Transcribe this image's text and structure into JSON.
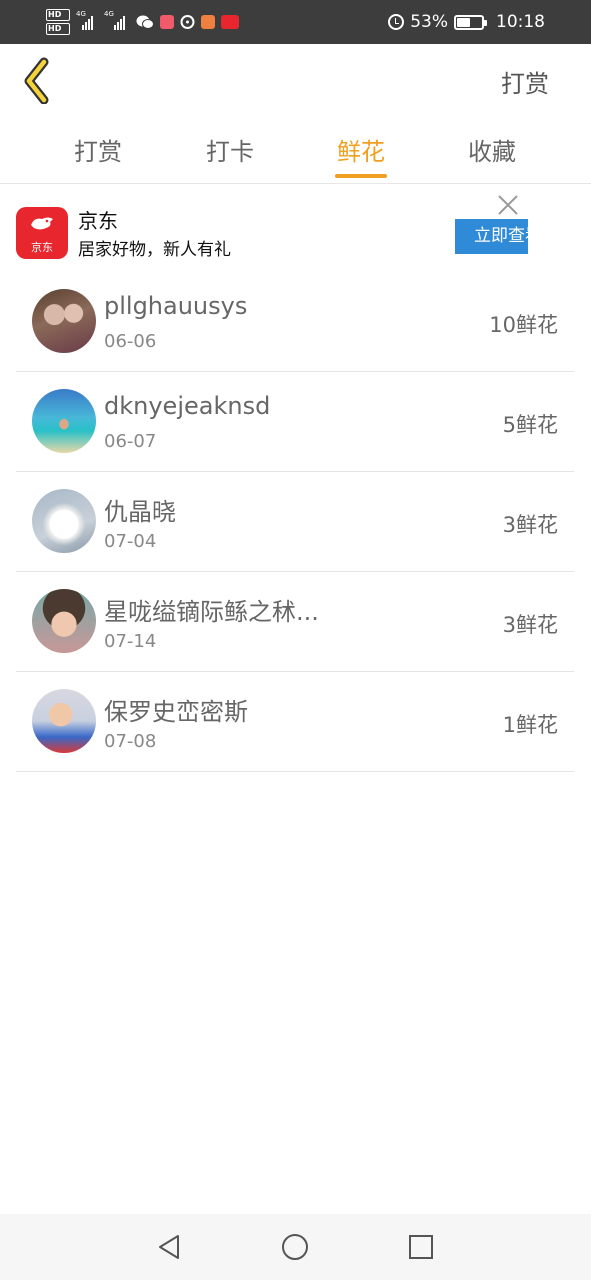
{
  "status_bar": {
    "battery_percent": "53%",
    "battery_level": 0.53,
    "time": "10:18",
    "hd1": "HD",
    "hd2": "HD",
    "net1": "4G",
    "net2": "4G"
  },
  "header": {
    "right_action": "打赏"
  },
  "tabs": [
    {
      "label": "打赏",
      "active": false
    },
    {
      "label": "打卡",
      "active": false
    },
    {
      "label": "鲜花",
      "active": true
    },
    {
      "label": "收藏",
      "active": false
    }
  ],
  "ad": {
    "logo_text": "京东",
    "title": "京东",
    "subtitle": "居家好物，新人有礼",
    "button_label": "立即查看"
  },
  "rows": [
    {
      "name": "pllghauusys",
      "date": "06-06",
      "count": "10鲜花"
    },
    {
      "name": "dknyejeaknsd",
      "date": "06-07",
      "count": "5鲜花"
    },
    {
      "name": "仇晶晓",
      "date": "07-04",
      "count": "3鲜花"
    },
    {
      "name": "星咙缢镝际鲧之秫...",
      "date": "07-14",
      "count": "3鲜花"
    },
    {
      "name": "保罗史峦密斯",
      "date": "07-08",
      "count": "1鲜花"
    }
  ],
  "colors": {
    "accent": "#f0a020",
    "status_bar_bg": "#3d3d3d",
    "ad_button": "#2f8ad8",
    "jd_red": "#e8262e"
  }
}
